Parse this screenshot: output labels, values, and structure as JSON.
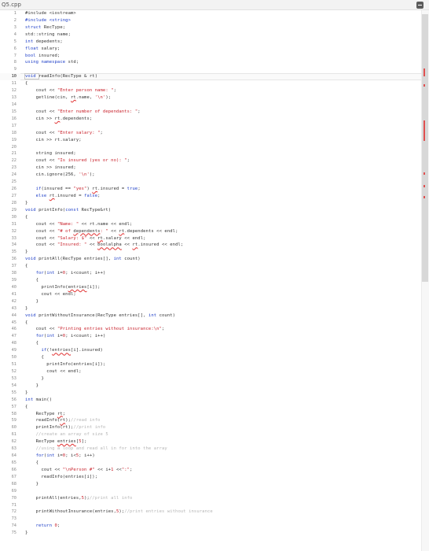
{
  "window": {
    "tab_label": "Q5.cpp"
  },
  "editor": {
    "current_line": 10,
    "lines": [
      {
        "n": "1",
        "t": [
          [
            "plain",
            "#include <iostream>"
          ]
        ]
      },
      {
        "n": "2",
        "t": [
          [
            "kw",
            "#include <string>"
          ]
        ]
      },
      {
        "n": "3",
        "t": [
          [
            "kw",
            "struct "
          ],
          [
            "plain",
            "RecType;"
          ]
        ]
      },
      {
        "n": "4",
        "t": [
          [
            "plain",
            "std::string name;"
          ]
        ]
      },
      {
        "n": "5",
        "t": [
          [
            "kw",
            "int "
          ],
          [
            "plain",
            "depedents;"
          ]
        ]
      },
      {
        "n": "6",
        "t": [
          [
            "kw",
            "float "
          ],
          [
            "plain",
            "salary;"
          ]
        ]
      },
      {
        "n": "7",
        "t": [
          [
            "kw",
            "bool "
          ],
          [
            "plain",
            "insured;"
          ]
        ]
      },
      {
        "n": "8",
        "t": [
          [
            "kw",
            "using namespace "
          ],
          [
            "plain",
            "std;"
          ]
        ]
      },
      {
        "n": "9",
        "t": []
      },
      {
        "n": "10",
        "t": [
          [
            "kw",
            "void "
          ],
          [
            "plain",
            "readInfo(RecType & rt)"
          ]
        ]
      },
      {
        "n": "11",
        "t": [
          [
            "plain",
            "{"
          ]
        ]
      },
      {
        "n": "12",
        "t": [
          [
            "plain",
            "    cout << "
          ],
          [
            "str",
            "\"Enter person name: \""
          ],
          [
            "plain",
            ";"
          ]
        ]
      },
      {
        "n": "13",
        "t": [
          [
            "plain",
            "    getline(cin, "
          ],
          [
            "err",
            "rt"
          ],
          [
            "plain",
            ".name, "
          ],
          [
            "str",
            "'\\n'"
          ],
          [
            "plain",
            ");"
          ]
        ]
      },
      {
        "n": "14",
        "t": []
      },
      {
        "n": "15",
        "t": [
          [
            "plain",
            "    cout << "
          ],
          [
            "str",
            "\"Enter number of dependants: \""
          ],
          [
            "plain",
            ";"
          ]
        ]
      },
      {
        "n": "16",
        "t": [
          [
            "plain",
            "    cin >> "
          ],
          [
            "err",
            "rt"
          ],
          [
            "plain",
            ".dependents;"
          ]
        ]
      },
      {
        "n": "17",
        "t": []
      },
      {
        "n": "18",
        "t": [
          [
            "plain",
            "    cout << "
          ],
          [
            "str",
            "\"Enter salary: \""
          ],
          [
            "plain",
            ";"
          ]
        ]
      },
      {
        "n": "19",
        "t": [
          [
            "plain",
            "    cin >> rt.salary;"
          ]
        ]
      },
      {
        "n": "20",
        "t": []
      },
      {
        "n": "21",
        "t": [
          [
            "plain",
            "    string insured;"
          ]
        ]
      },
      {
        "n": "22",
        "t": [
          [
            "plain",
            "    cout << "
          ],
          [
            "str",
            "\"Is insured (yes or no): \""
          ],
          [
            "plain",
            ";"
          ]
        ]
      },
      {
        "n": "23",
        "t": [
          [
            "plain",
            "    cin >> insured;"
          ]
        ]
      },
      {
        "n": "24",
        "t": [
          [
            "plain",
            "    cin.ignore(256, "
          ],
          [
            "str",
            "'\\n'"
          ],
          [
            "plain",
            ");"
          ]
        ]
      },
      {
        "n": "25",
        "t": []
      },
      {
        "n": "26",
        "t": [
          [
            "kw",
            "    if"
          ],
          [
            "plain",
            "(insured == "
          ],
          [
            "str",
            "\"yes\""
          ],
          [
            "plain",
            ") "
          ],
          [
            "err",
            "rt"
          ],
          [
            "plain",
            ".insured = "
          ],
          [
            "kw",
            "true"
          ],
          [
            "plain",
            ";"
          ]
        ]
      },
      {
        "n": "27",
        "t": [
          [
            "kw",
            "    else "
          ],
          [
            "err",
            "rt"
          ],
          [
            "plain",
            ".insured = "
          ],
          [
            "kw",
            "false"
          ],
          [
            "plain",
            ";"
          ]
        ]
      },
      {
        "n": "28",
        "t": [
          [
            "plain",
            "}"
          ]
        ]
      },
      {
        "n": "29",
        "t": [
          [
            "kw",
            "void "
          ],
          [
            "plain",
            "printInfo("
          ],
          [
            "kw",
            "const "
          ],
          [
            "plain",
            "RecType&rt)"
          ]
        ]
      },
      {
        "n": "30",
        "t": [
          [
            "plain",
            "{"
          ]
        ]
      },
      {
        "n": "31",
        "t": [
          [
            "plain",
            "    cout << "
          ],
          [
            "str",
            "\"Name: \""
          ],
          [
            "plain",
            " << rt.name << endl;"
          ]
        ]
      },
      {
        "n": "32",
        "t": [
          [
            "plain",
            "    cout << "
          ],
          [
            "str",
            "\"# of "
          ],
          [
            "err",
            "dependents"
          ],
          [
            "str",
            ": \""
          ],
          [
            "plain",
            " << "
          ],
          [
            "err",
            "rt"
          ],
          [
            "plain",
            ".dependents << endl;"
          ]
        ]
      },
      {
        "n": "33",
        "t": [
          [
            "plain",
            "    cout << "
          ],
          [
            "str",
            "\"Salary: $\""
          ],
          [
            "plain",
            " << "
          ],
          [
            "err",
            "rt"
          ],
          [
            "plain",
            ".salary << endl;"
          ]
        ]
      },
      {
        "n": "34",
        "t": [
          [
            "plain",
            "    cout << "
          ],
          [
            "str",
            "\"Insured: \""
          ],
          [
            "plain",
            " << "
          ],
          [
            "err",
            "boolalpha"
          ],
          [
            "plain",
            " << "
          ],
          [
            "err",
            "rt"
          ],
          [
            "plain",
            ".insured << endl;"
          ]
        ]
      },
      {
        "n": "35",
        "t": [
          [
            "plain",
            "}"
          ]
        ]
      },
      {
        "n": "36",
        "t": [
          [
            "kw",
            "void "
          ],
          [
            "plain",
            "printAll(RecType entries[], "
          ],
          [
            "kw",
            "int "
          ],
          [
            "plain",
            "count)"
          ]
        ]
      },
      {
        "n": "37",
        "t": [
          [
            "plain",
            "{"
          ]
        ]
      },
      {
        "n": "38",
        "t": [
          [
            "kw",
            "    for"
          ],
          [
            "plain",
            "("
          ],
          [
            "kw",
            "int "
          ],
          [
            "plain",
            "i="
          ],
          [
            "str",
            "0"
          ],
          [
            "plain",
            "; i<count; i++)"
          ]
        ]
      },
      {
        "n": "39",
        "t": [
          [
            "plain",
            "    {"
          ]
        ]
      },
      {
        "n": "40",
        "t": [
          [
            "plain",
            "      printInfo("
          ],
          [
            "err",
            "entries"
          ],
          [
            "plain",
            "[i]);"
          ]
        ]
      },
      {
        "n": "41",
        "t": [
          [
            "plain",
            "      cout << endl;"
          ]
        ]
      },
      {
        "n": "42",
        "t": [
          [
            "plain",
            "    }"
          ]
        ]
      },
      {
        "n": "43",
        "t": [
          [
            "plain",
            "}"
          ]
        ]
      },
      {
        "n": "44",
        "t": [
          [
            "kw",
            "void "
          ],
          [
            "plain",
            "printWithoutInsurance(RecType entries[], "
          ],
          [
            "kw",
            "int "
          ],
          [
            "plain",
            "count)"
          ]
        ]
      },
      {
        "n": "45",
        "t": [
          [
            "plain",
            "{"
          ]
        ]
      },
      {
        "n": "46",
        "t": [
          [
            "plain",
            "    cout << "
          ],
          [
            "str",
            "\"Printing entries without insurance:\\n\""
          ],
          [
            "plain",
            ";"
          ]
        ]
      },
      {
        "n": "47",
        "t": [
          [
            "kw",
            "    for"
          ],
          [
            "plain",
            "("
          ],
          [
            "kw",
            "int "
          ],
          [
            "plain",
            "i="
          ],
          [
            "str",
            "0"
          ],
          [
            "plain",
            "; i<count; i++)"
          ]
        ]
      },
      {
        "n": "48",
        "t": [
          [
            "plain",
            "    {"
          ]
        ]
      },
      {
        "n": "49",
        "t": [
          [
            "kw",
            "      if"
          ],
          [
            "plain",
            "(!"
          ],
          [
            "err",
            "entries"
          ],
          [
            "plain",
            "[i].insured)"
          ]
        ]
      },
      {
        "n": "50",
        "t": [
          [
            "plain",
            "      {"
          ]
        ]
      },
      {
        "n": "51",
        "t": [
          [
            "plain",
            "        printInfo(entries[i]);"
          ]
        ]
      },
      {
        "n": "52",
        "t": [
          [
            "plain",
            "        cout << endl;"
          ]
        ]
      },
      {
        "n": "53",
        "t": [
          [
            "plain",
            "      }"
          ]
        ]
      },
      {
        "n": "54",
        "t": [
          [
            "plain",
            "    }"
          ]
        ]
      },
      {
        "n": "55",
        "t": [
          [
            "plain",
            "}"
          ]
        ]
      },
      {
        "n": "56",
        "t": [
          [
            "kw",
            "int "
          ],
          [
            "plain",
            "main()"
          ]
        ]
      },
      {
        "n": "57",
        "t": [
          [
            "plain",
            "{"
          ]
        ]
      },
      {
        "n": "58",
        "t": [
          [
            "plain",
            "    RecType "
          ],
          [
            "err",
            "rt"
          ],
          [
            "plain",
            ";"
          ]
        ]
      },
      {
        "n": "59",
        "t": [
          [
            "plain",
            "    readInfo("
          ],
          [
            "err",
            "rt"
          ],
          [
            "plain",
            ");"
          ],
          [
            "cmt",
            "//read info"
          ]
        ]
      },
      {
        "n": "60",
        "t": [
          [
            "plain",
            "    printInfo(rt);"
          ],
          [
            "cmt",
            "//print info"
          ]
        ]
      },
      {
        "n": "61",
        "t": [
          [
            "cmt",
            "    //create an array of size 5"
          ]
        ]
      },
      {
        "n": "62",
        "t": [
          [
            "plain",
            "    RecType "
          ],
          [
            "err",
            "entries"
          ],
          [
            "plain",
            "["
          ],
          [
            "str",
            "5"
          ],
          [
            "plain",
            "];"
          ]
        ]
      },
      {
        "n": "63",
        "t": [
          [
            "cmt",
            "    //using a loop and read all in for into the array"
          ]
        ]
      },
      {
        "n": "64",
        "t": [
          [
            "kw",
            "    for"
          ],
          [
            "plain",
            "("
          ],
          [
            "kw",
            "int "
          ],
          [
            "plain",
            "i="
          ],
          [
            "str",
            "0"
          ],
          [
            "plain",
            "; i<"
          ],
          [
            "str",
            "5"
          ],
          [
            "plain",
            "; i++)"
          ]
        ]
      },
      {
        "n": "65",
        "t": [
          [
            "plain",
            "    {"
          ]
        ]
      },
      {
        "n": "66",
        "t": [
          [
            "plain",
            "      cout << "
          ],
          [
            "str",
            "\"\\nPerson #\""
          ],
          [
            "plain",
            " << i+"
          ],
          [
            "str",
            "1"
          ],
          [
            "plain",
            " <<"
          ],
          [
            "str",
            "\":\""
          ],
          [
            "plain",
            ";"
          ]
        ]
      },
      {
        "n": "67",
        "t": [
          [
            "plain",
            "      readInfo(entries[i]);"
          ]
        ]
      },
      {
        "n": "68",
        "t": [
          [
            "plain",
            "    }"
          ]
        ]
      },
      {
        "n": "69",
        "t": []
      },
      {
        "n": "70",
        "t": [
          [
            "plain",
            "    printAll(entries,"
          ],
          [
            "str",
            "5"
          ],
          [
            "plain",
            ");"
          ],
          [
            "cmt",
            "//print all info"
          ]
        ]
      },
      {
        "n": "71",
        "t": []
      },
      {
        "n": "72",
        "t": [
          [
            "plain",
            "    printWithoutInsurance(entries,"
          ],
          [
            "str",
            "5"
          ],
          [
            "plain",
            ");"
          ],
          [
            "cmt",
            "//print entries without insurance"
          ]
        ]
      },
      {
        "n": "73",
        "t": []
      },
      {
        "n": "74",
        "t": [
          [
            "kw",
            "    return "
          ],
          [
            "str",
            "0"
          ],
          [
            "plain",
            ";"
          ]
        ]
      },
      {
        "n": "75",
        "t": [
          [
            "plain",
            "}"
          ]
        ]
      }
    ]
  },
  "scrollbar": {
    "markers_color": "#e05050"
  },
  "icons": {
    "settings": "settings-icon"
  }
}
